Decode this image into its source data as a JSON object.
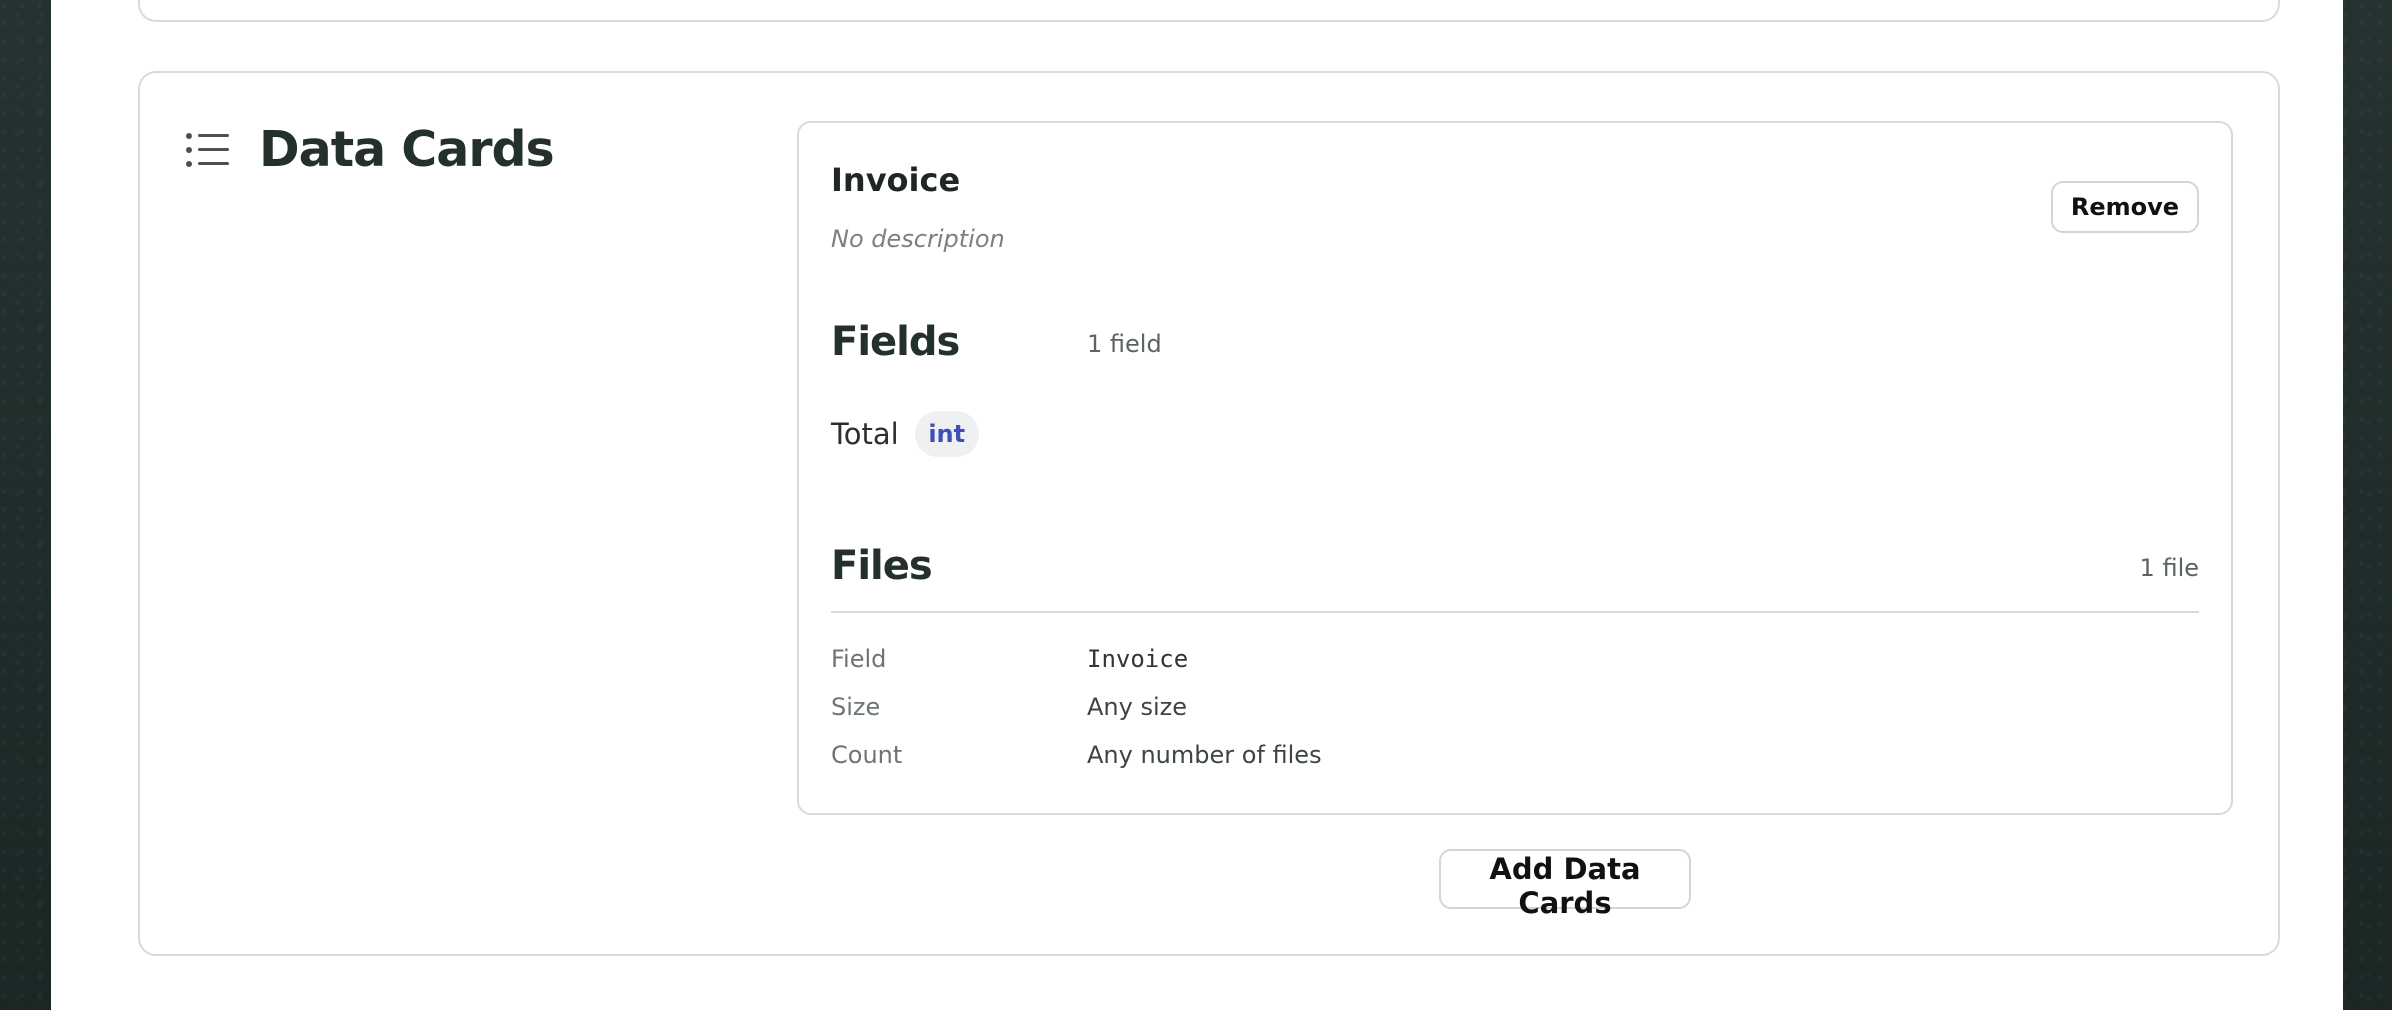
{
  "section": {
    "icon": "list-icon",
    "title": "Data Cards"
  },
  "card": {
    "title": "Invoice",
    "description": "No description",
    "remove_label": "Remove",
    "fields": {
      "title": "Fields",
      "count_label": "1 field",
      "items": [
        {
          "name": "Total",
          "type": "int"
        }
      ]
    },
    "files": {
      "title": "Files",
      "count_label": "1 file",
      "rows": [
        {
          "key": "Field",
          "value": "Invoice"
        },
        {
          "key": "Size",
          "value": "Any size"
        },
        {
          "key": "Count",
          "value": "Any number of files"
        }
      ]
    }
  },
  "add_button_label": "Add Data Cards",
  "colors": {
    "background": "#1f2b2a",
    "surface": "#ffffff",
    "border": "#d8dbd9",
    "accent": "#3f4fb8",
    "badge_bg": "#eef0f1"
  }
}
